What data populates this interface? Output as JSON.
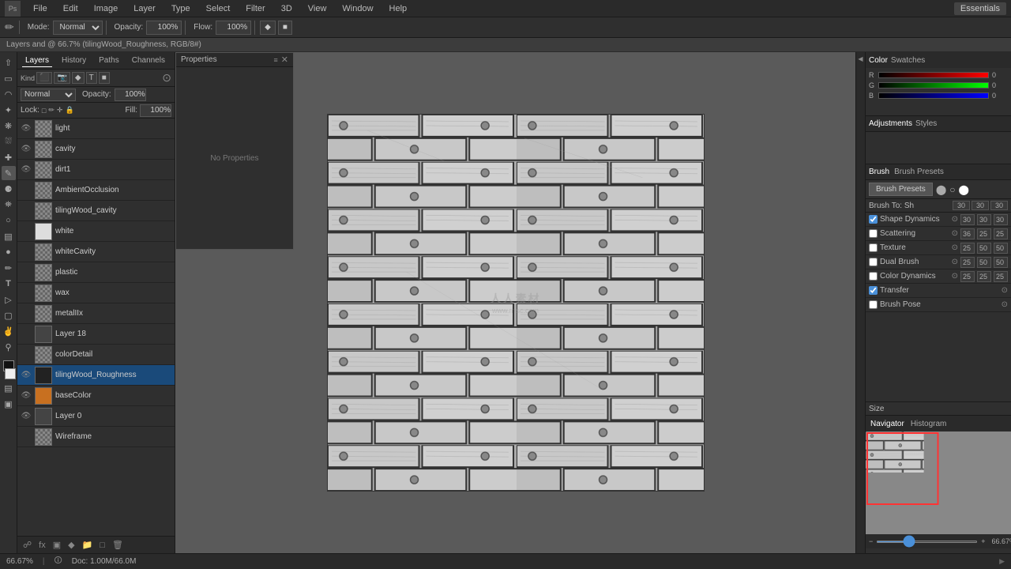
{
  "app": {
    "title": "Essentials",
    "document_title": "Layers and @ 66.7% (tilingWood_Roughness, RGB/8#)"
  },
  "top_menu": {
    "items": [
      "PS",
      "File",
      "Edit",
      "Image",
      "Layer",
      "Type",
      "Select",
      "Filter",
      "3D",
      "View",
      "Window",
      "Help"
    ]
  },
  "toolbar": {
    "mode_label": "Mode:",
    "mode_value": "Normal",
    "opacity_label": "Opacity:",
    "opacity_value": "100%",
    "flow_label": "Flow:",
    "flow_value": "100%"
  },
  "layers_panel": {
    "tabs": [
      "Layers",
      "History",
      "Paths",
      "Channels"
    ],
    "mode": "Normal",
    "opacity_label": "Opacity:",
    "opacity_value": "100%",
    "fill_label": "Fill:",
    "fill_value": "100%",
    "lock_label": "Lock:",
    "layers": [
      {
        "name": "light",
        "visible": true,
        "type": "checker"
      },
      {
        "name": "cavity",
        "visible": true,
        "type": "checker"
      },
      {
        "name": "dirt1",
        "visible": true,
        "type": "checker"
      },
      {
        "name": "AmbientOcclusion",
        "visible": false,
        "type": "checker"
      },
      {
        "name": "tilingWood_cavity",
        "visible": false,
        "type": "checker"
      },
      {
        "name": "white",
        "visible": false,
        "type": "solid_white"
      },
      {
        "name": "whiteCavity",
        "visible": false,
        "type": "checker"
      },
      {
        "name": "plastic",
        "visible": false,
        "type": "checker"
      },
      {
        "name": "wax",
        "visible": false,
        "type": "checker"
      },
      {
        "name": "metalIIx",
        "visible": false,
        "type": "checker"
      },
      {
        "name": "Layer 18",
        "visible": false,
        "type": "blank"
      },
      {
        "name": "colorDetail",
        "visible": false,
        "type": "checker"
      },
      {
        "name": "tilingWood_Roughness",
        "visible": true,
        "type": "active_dark"
      },
      {
        "name": "baseColor",
        "visible": true,
        "type": "solid_orange"
      },
      {
        "name": "Layer 0",
        "visible": true,
        "type": "blank"
      },
      {
        "name": "Wireframe",
        "visible": false,
        "type": "checker"
      }
    ]
  },
  "properties_panel": {
    "title": "Properties",
    "content": "No Properties"
  },
  "brush_panel": {
    "tabs": [
      "Brush",
      "Brush Presets"
    ],
    "preset_btn": "Brush Presets",
    "brush_to_label": "Brush To: Shape",
    "col_headers": [
      "",
      "30",
      "30",
      "30"
    ],
    "col_headers2": [
      "",
      "36",
      "25",
      "25"
    ],
    "col_headers3": [
      "",
      "25",
      "50",
      "50"
    ],
    "col_headers4": [
      "",
      "25",
      "50",
      "50"
    ],
    "settings": [
      {
        "checked": true,
        "label": "Shape Dynamics",
        "has_icon": true
      },
      {
        "checked": false,
        "label": "Scattering",
        "has_icon": true
      },
      {
        "checked": false,
        "label": "Texture",
        "has_icon": true
      },
      {
        "checked": false,
        "label": "Dual Brush",
        "has_icon": true
      },
      {
        "checked": false,
        "label": "Color Dynamics",
        "has_icon": true
      },
      {
        "checked": true,
        "label": "Transfer",
        "has_icon": true
      },
      {
        "checked": false,
        "label": "Brush Pose",
        "has_icon": true
      }
    ],
    "size_label": "Size"
  },
  "navigator": {
    "tabs": [
      "Navigator",
      "Histogram"
    ],
    "zoom_value": "66.67%"
  },
  "right_sidebar": {
    "items": [
      {
        "label": "Color",
        "icon": "color-icon"
      },
      {
        "label": "Swatches",
        "icon": "swatches-icon"
      },
      {
        "label": "Adjustments",
        "icon": "adjustments-icon"
      },
      {
        "label": "Styles",
        "icon": "styles-icon"
      }
    ]
  },
  "status_bar": {
    "zoom": "66.67%",
    "doc_size": "Doc: 1.00M/66.0M"
  },
  "colors": {
    "active_layer_bg": "#1a4a7a",
    "panel_bg": "#2f2f2f",
    "dark_bg": "#2a2a2a",
    "border": "#1a1a1a",
    "accent": "#4a90d9"
  }
}
